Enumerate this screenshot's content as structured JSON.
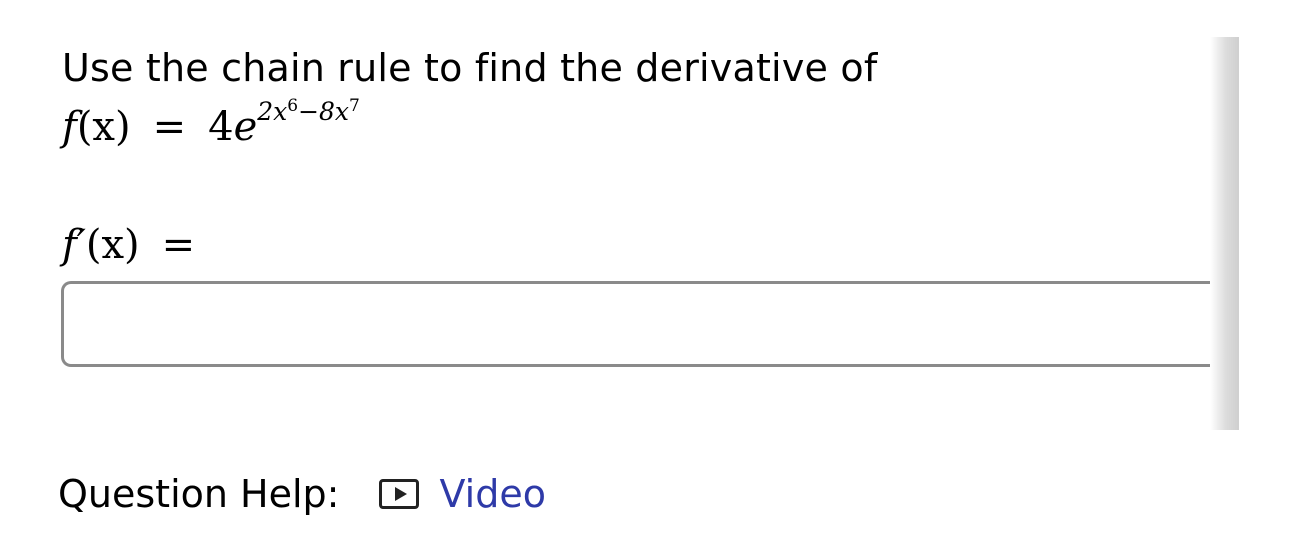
{
  "question": {
    "prompt": "Use the chain rule to find the derivative of",
    "function_label": "f(x)",
    "function_lhs_name": "f",
    "function_lhs_arg": "(x)",
    "equals": "=",
    "coefficient": "4",
    "base": "e",
    "exponent_parts": [
      "2x",
      "6",
      "−8x",
      "7"
    ],
    "derivative_lhs_name": "f′",
    "derivative_lhs_arg": "(x)"
  },
  "answer": {
    "value": "",
    "placeholder": ""
  },
  "help": {
    "label": "Question Help:",
    "video_label": "Video"
  },
  "icons": {
    "video": "video-play-icon"
  },
  "colors": {
    "link": "#2e3aa8",
    "input_border": "#8a8a8a"
  }
}
